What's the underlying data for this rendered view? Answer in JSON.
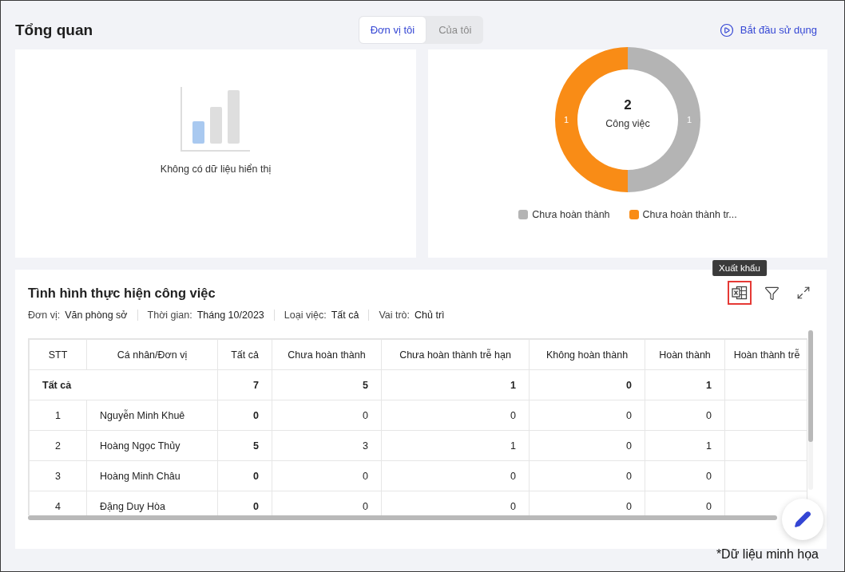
{
  "header": {
    "title": "Tổng quan",
    "tabs": [
      {
        "label": "Đơn vị tôi",
        "selected": true
      },
      {
        "label": "Của tôi",
        "selected": false
      }
    ],
    "start_link": "Bắt đầu sử dụng"
  },
  "empty_card": {
    "message": "Không có dữ liệu hiển thị"
  },
  "donut_card": {
    "total": "2",
    "total_label": "Công việc",
    "legend": [
      {
        "color": "#b4b4b4"
      },
      {
        "color": "#f98c16"
      }
    ],
    "chart_data": {
      "type": "donut",
      "categories": [
        "Chưa hoàn thành",
        "Chưa hoàn thành tr..."
      ],
      "values": [
        1,
        1
      ],
      "data_labels": true
    }
  },
  "progress_card": {
    "title": "Tình hình thực hiện công việc",
    "toolbar": {
      "export_tooltip": "Xuất khẩu",
      "export_highlighted": true
    },
    "filters": [
      {
        "label": "Đơn vị:",
        "value": "Văn phòng sở"
      },
      {
        "label": "Thời gian:",
        "value": "Tháng 10/2023"
      },
      {
        "label": "Loại việc:",
        "value": "Tất cả"
      },
      {
        "label": "Vai trò:",
        "value": "Chủ trì"
      }
    ],
    "table": {
      "columns": [
        "STT",
        "Cá nhân/Đơn vị",
        "Tất cả",
        "Chưa hoàn thành",
        "Chưa hoàn thành trễ hạn",
        "Không hoàn thành",
        "Hoàn thành",
        "Hoàn thành trễ"
      ],
      "total_row": {
        "label": "Tất cả",
        "values": [
          "7",
          "5",
          "1",
          "0",
          "1"
        ]
      },
      "rows": [
        {
          "stt": "1",
          "name": "Nguyễn Minh Khuê",
          "values": [
            "0",
            "0",
            "0",
            "0",
            "0"
          ]
        },
        {
          "stt": "2",
          "name": "Hoàng Ngọc Thủy",
          "values": [
            "5",
            "3",
            "1",
            "0",
            "1"
          ]
        },
        {
          "stt": "3",
          "name": "Hoàng Minh Châu",
          "values": [
            "0",
            "0",
            "0",
            "0",
            "0"
          ]
        },
        {
          "stt": "4",
          "name": "Đặng Duy Hòa",
          "values": [
            "0",
            "0",
            "0",
            "0",
            "0"
          ]
        }
      ]
    }
  },
  "footnote": "*Dữ liệu minh họa"
}
